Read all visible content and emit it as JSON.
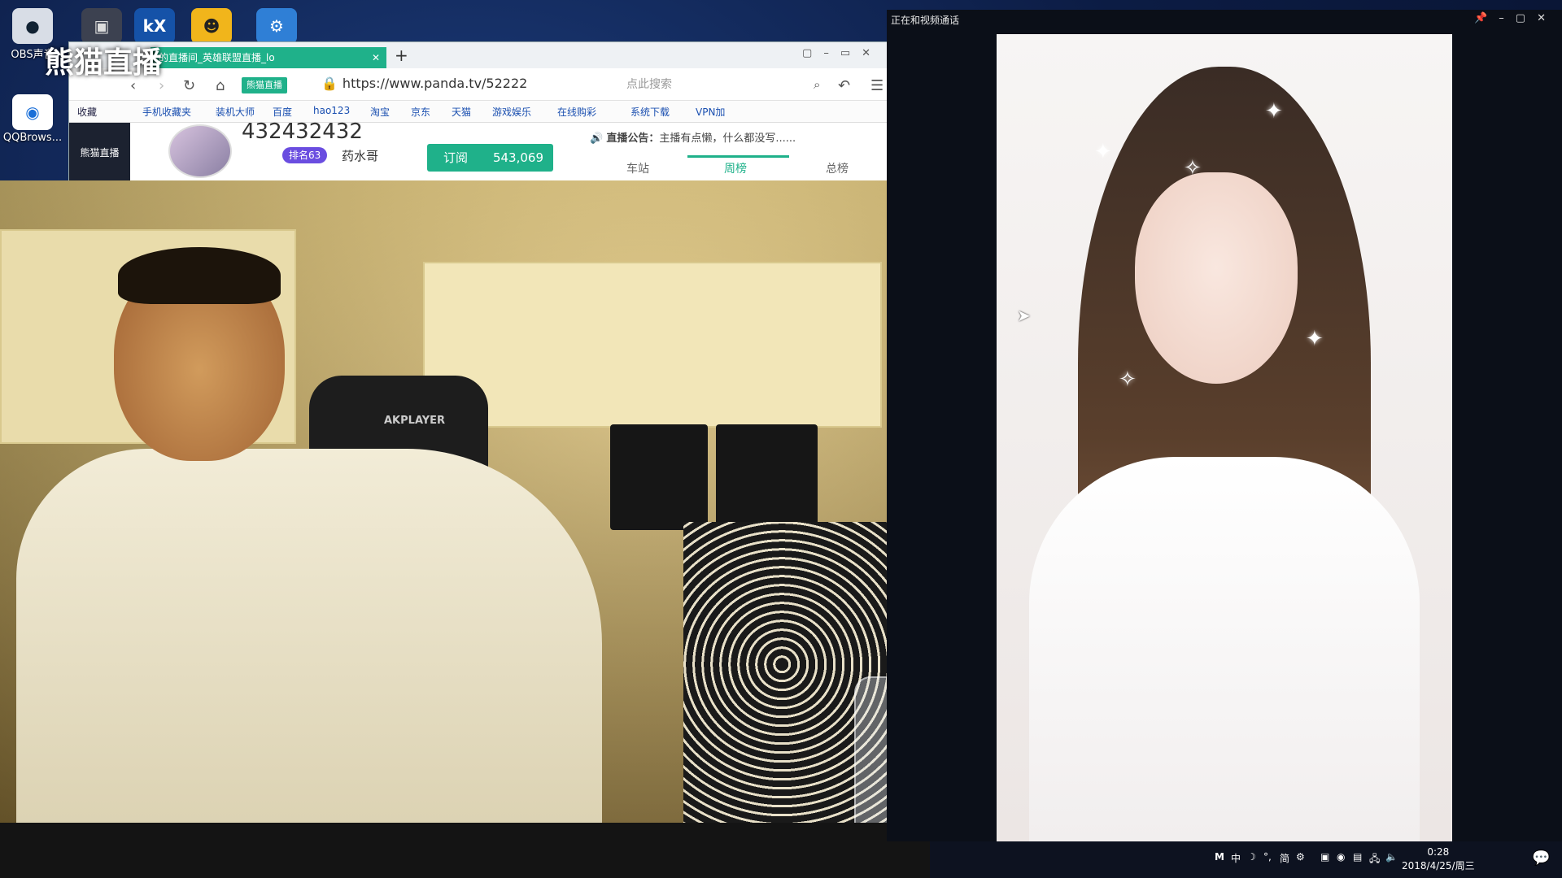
{
  "desktop": {
    "icons": [
      {
        "label": "OBS声音",
        "icon": "obs-icon"
      },
      {
        "label": "QQBrows...",
        "icon": "qqbrowser-icon"
      }
    ],
    "overlay_logo": "熊猫直播"
  },
  "browser": {
    "tab_title": "的直播间_英雄联盟直播_lo",
    "url": "https://www.panda.tv/52222",
    "site_badge": "熊猫直播",
    "search_placeholder": "点此搜索",
    "bookmarks": [
      "收藏",
      "手机收藏夹",
      "装机大师",
      "百度",
      "hao123",
      "淘宝",
      "京东",
      "天猫",
      "游戏娱乐",
      "在线购彩",
      "系统下载",
      "VPN加"
    ],
    "sidebar_logo": "熊猫直播",
    "room_id": "432432432",
    "rank_badge": "排名63",
    "streamer_name": "药水哥",
    "subscribe_label": "订阅",
    "subscribe_count": "543,069",
    "notice_label": "直播公告：",
    "notice_text": "主播有点懒，什么都没写......",
    "rank_tabs": [
      "车站",
      "周榜",
      "总榜"
    ],
    "active_rank_tab": "周榜"
  },
  "webcam": {
    "chair_brand": "AKPLAYER"
  },
  "call_window": {
    "title": "正在和视频通话",
    "controls": [
      "pin",
      "minimize",
      "maximize",
      "close"
    ]
  },
  "taskbar": {
    "ime_items": [
      "M",
      "中",
      "简"
    ],
    "time": "0:28",
    "date": "2018/4/25/周三"
  },
  "colors": {
    "accent": "#1fb18a",
    "rank_badge": "#6a4de0",
    "taskbar": "#0d1220"
  }
}
